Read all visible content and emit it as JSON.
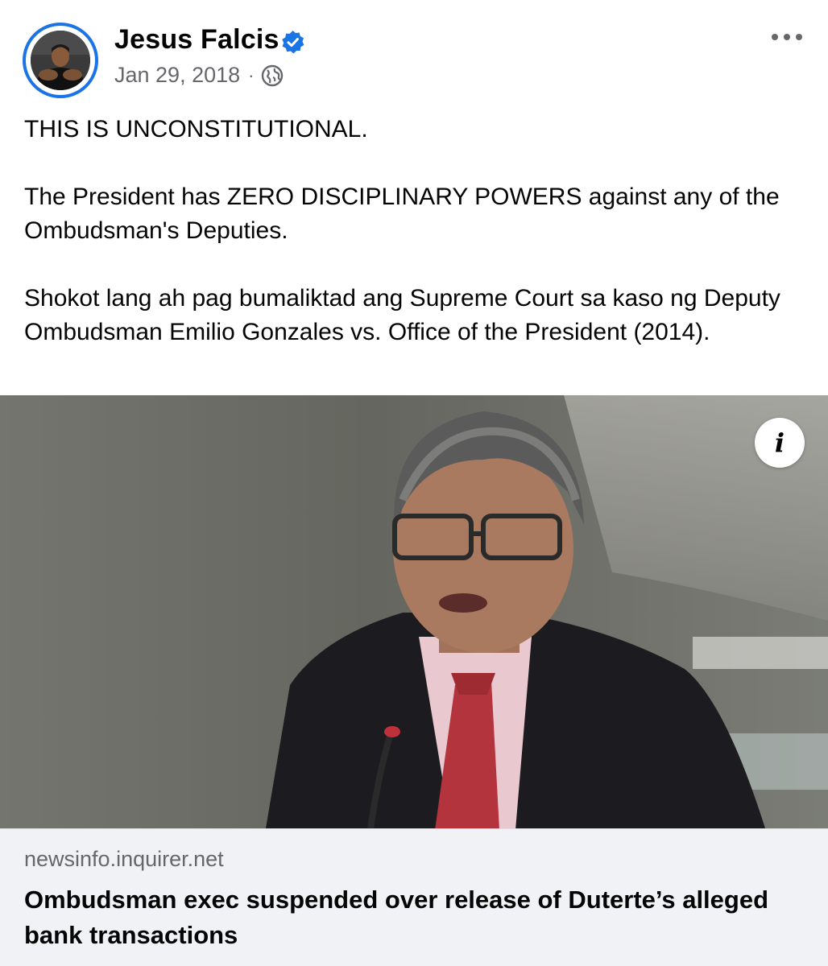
{
  "post": {
    "author": {
      "name": "Jesus Falcis",
      "verified": true
    },
    "timestamp": "Jan 29, 2018",
    "meta_separator": "·",
    "audience_icon": "globe-icon",
    "more_icon": "more-options-icon",
    "paragraphs": [
      "THIS IS UNCONSTITUTIONAL.",
      "The President has ZERO DISCIPLINARY POWERS against any of the Ombudsman's Deputies.",
      "Shokot lang ah pag bumaliktad ang Supreme Court sa kaso ng Deputy Ombudsman Emilio Gonzales vs. Office of the President (2014)."
    ]
  },
  "link_preview": {
    "info_glyph": "i",
    "domain": "newsinfo.inquirer.net",
    "title": "Ombudsman exec suspended over release of Duterte’s alleged bank transactions"
  },
  "colors": {
    "accent": "#1b74e4",
    "text_primary": "#050505",
    "text_secondary": "#65676b",
    "link_footer_bg": "#f0f2f5"
  }
}
